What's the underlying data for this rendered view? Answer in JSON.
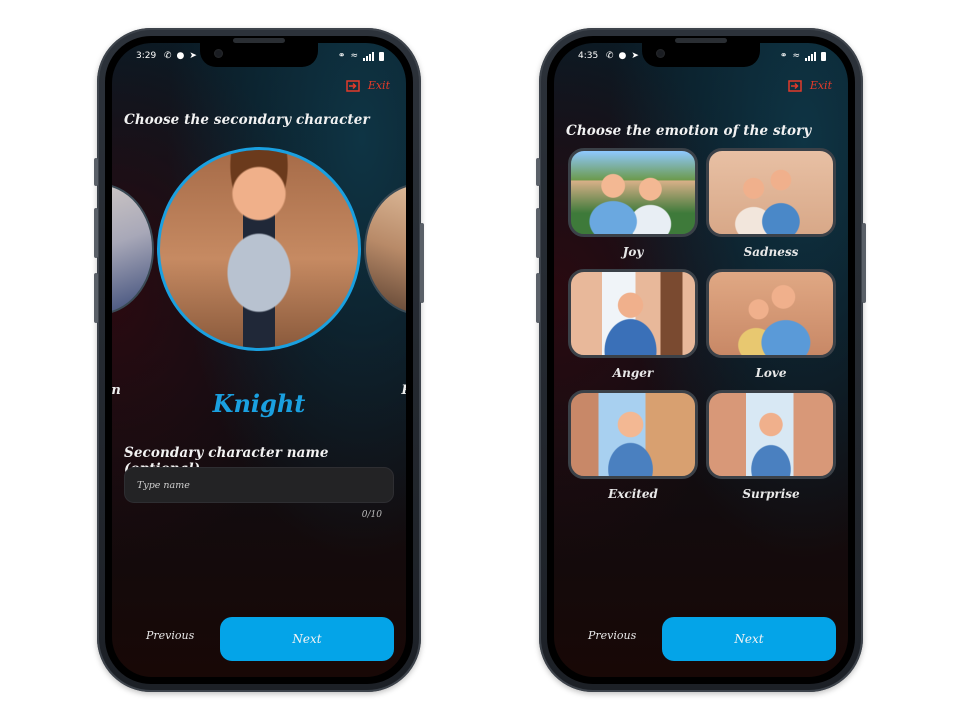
{
  "left_screen": {
    "status_bar": {
      "time": "3:29",
      "notification_icons": [
        "whatsapp-icon",
        "chat-bubble-icon",
        "telegram-icon"
      ],
      "system_icons": [
        "vpn-key-icon",
        "wifi-icon",
        "signal-icon",
        "battery-icon"
      ]
    },
    "exit_label": "Exit",
    "heading": "Choose the secondary character",
    "carousel": {
      "previous_partial_label": "ian",
      "selected_label": "Knight",
      "next_partial_label": "Pr"
    },
    "name_section": {
      "label": "Secondary character name (optional)",
      "input_value": "",
      "input_placeholder": "Type name",
      "counter": "0/10"
    },
    "nav": {
      "previous_label": "Previous",
      "next_label": "Next"
    }
  },
  "right_screen": {
    "status_bar": {
      "time": "4:35",
      "notification_icons": [
        "whatsapp-icon",
        "chat-bubble-icon",
        "telegram-icon"
      ],
      "system_icons": [
        "vpn-key-icon",
        "wifi-icon",
        "signal-icon",
        "battery-icon"
      ]
    },
    "exit_label": "Exit",
    "heading": "Choose the emotion of the story",
    "emotions": [
      {
        "label": "Joy"
      },
      {
        "label": "Sadness"
      },
      {
        "label": "Anger"
      },
      {
        "label": "Love"
      },
      {
        "label": "Excited"
      },
      {
        "label": "Surprise"
      }
    ],
    "nav": {
      "previous_label": "Previous",
      "next_label": "Next"
    }
  },
  "colors": {
    "accent": "#04a4e8",
    "selected_ring": "#1aa0e0",
    "exit": "#e33a2a",
    "input_bg": "#232325"
  }
}
